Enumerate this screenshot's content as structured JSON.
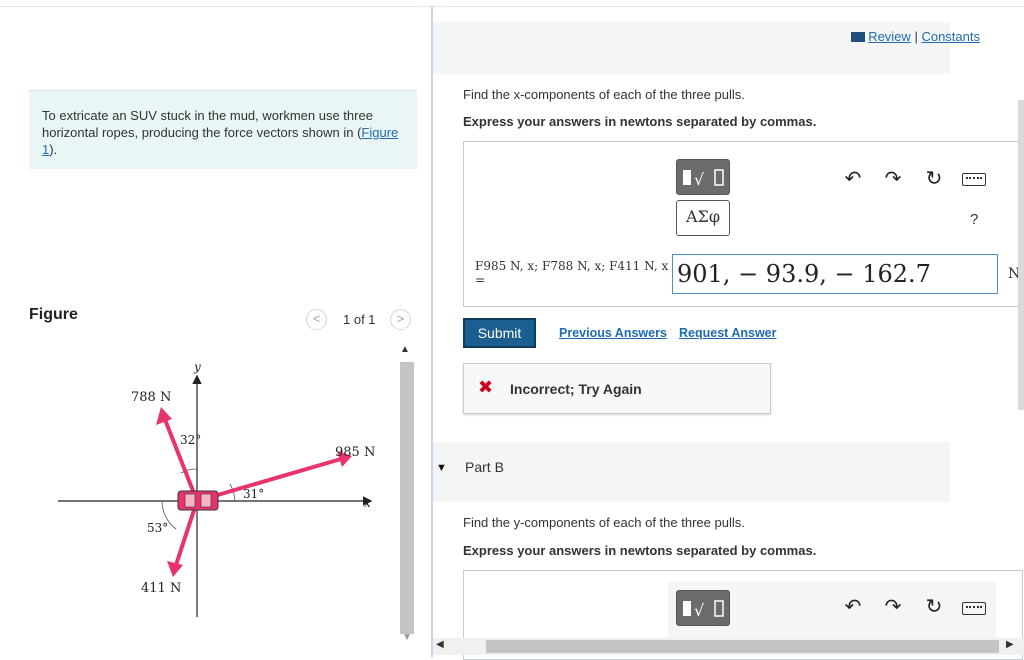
{
  "header": {
    "review_label": "Review",
    "separator": "|",
    "constants_label": "Constants"
  },
  "intro": {
    "text": "To extricate an SUV stuck in the mud, workmen use three horizontal ropes, producing the force vectors shown in ",
    "figure_link": "Figure 1",
    "suffix": ")."
  },
  "figure_panel": {
    "title": "Figure",
    "pager": "1 of 1",
    "prev_icon": "chevron-left-icon",
    "next_icon": "chevron-right-icon",
    "labels": {
      "y_axis": "y",
      "x_axis": "x",
      "f788": "788 N",
      "f985": "985 N",
      "f411": "411 N",
      "angle32": "32°",
      "angle31": "31°",
      "angle53": "53°"
    },
    "colors": {
      "force_vector": "#e8336d",
      "suv": "#e8336d",
      "axis": "#222222"
    }
  },
  "partA": {
    "question": "Find the x-components of each of the three pulls.",
    "instruction": "Express your answers in newtons separated by commas.",
    "toolbar": {
      "templates_icon": "templates-icon",
      "greek_label": "ΑΣφ",
      "undo_icon": "undo-icon",
      "redo_icon": "redo-icon",
      "reset_icon": "reset-icon",
      "keyboard_icon": "keyboard-icon",
      "help_label": "?"
    },
    "variable_label_l1": "F985 N, x; F788 N, x; F411 N, x",
    "variable_label_l2": "=",
    "answer_value": "901, − 93.9, − 162.7",
    "unit": "N",
    "submit_label": "Submit",
    "previous_answers_label": "Previous Answers",
    "request_answer_label": "Request Answer",
    "feedback": {
      "icon": "x-mark-icon",
      "text": "Incorrect; Try Again",
      "color": "#d0021b"
    }
  },
  "partB": {
    "title": "Part B",
    "question": "Find the y-components of each of the three pulls.",
    "instruction": "Express your answers in newtons separated by commas."
  }
}
